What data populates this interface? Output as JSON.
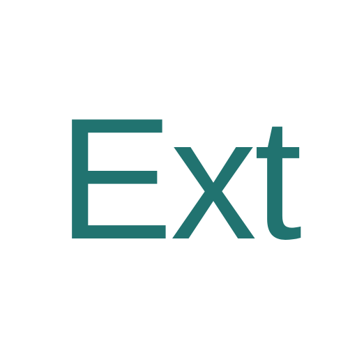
{
  "logo": {
    "text": "Ext",
    "color": "#217370"
  }
}
